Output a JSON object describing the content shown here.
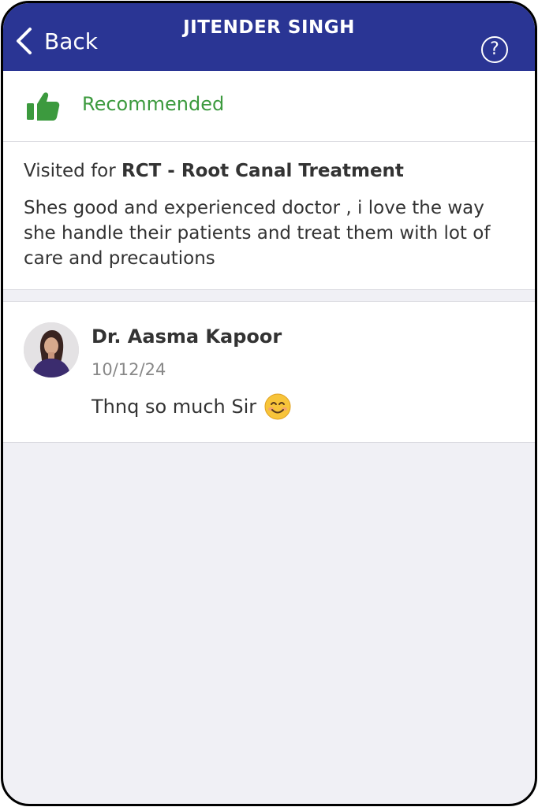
{
  "header": {
    "back_label": "Back",
    "title": "JITENDER SINGH",
    "help_label": "?"
  },
  "recommendation": {
    "label": "Recommended",
    "icon": "thumbs-up-icon",
    "color": "#3c9a3e"
  },
  "review": {
    "visited_prefix": "Visited for ",
    "treatment": "RCT - Root Canal Treatment",
    "text": "Shes good and experienced doctor , i love the way she handle their patients and treat them with lot of care and precautions"
  },
  "reply": {
    "doctor_name": "Dr. Aasma Kapoor",
    "date": "10/12/24",
    "text": "Thnq so much Sir",
    "emoji": "smiling-face-icon"
  },
  "colors": {
    "header_bg": "#2a3594",
    "page_bg": "#f0f0f5"
  }
}
